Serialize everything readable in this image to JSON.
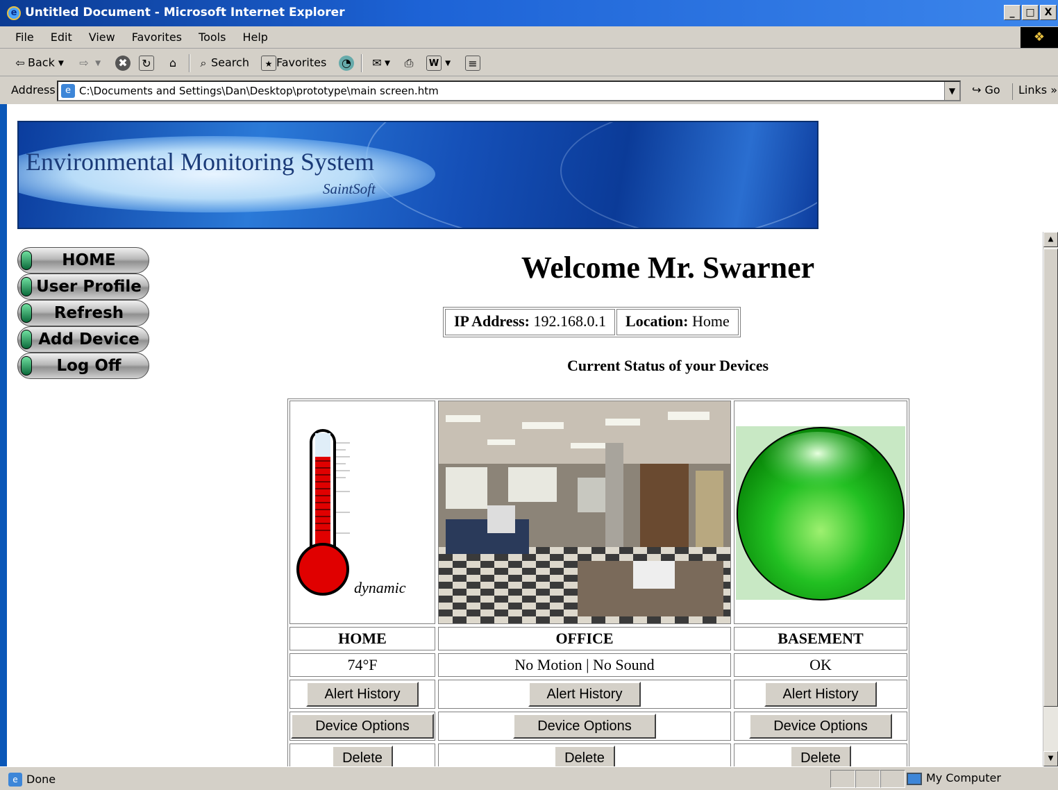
{
  "window": {
    "title": "Untitled Document - Microsoft Internet Explorer",
    "controls": [
      "_",
      "□",
      "X"
    ]
  },
  "menu": {
    "items": [
      "File",
      "Edit",
      "View",
      "Favorites",
      "Tools",
      "Help"
    ]
  },
  "toolbar": {
    "back": "Back",
    "search": "Search",
    "favorites": "Favorites"
  },
  "address": {
    "label": "Address",
    "url": "C:\\Documents and Settings\\Dan\\Desktop\\prototype\\main screen.htm",
    "go": "Go",
    "links": "Links"
  },
  "banner": {
    "title": "Environmental Monitoring System",
    "subtitle": "SaintSoft"
  },
  "nav": {
    "items": [
      "HOME",
      "User Profile",
      "Refresh",
      "Add Device",
      "Log Off"
    ]
  },
  "page": {
    "welcome": "Welcome Mr. Swarner",
    "ip_label": "IP Address:",
    "ip_value": "192.168.0.1",
    "location_label": "Location:",
    "location_value": "Home",
    "status_heading": "Current Status of your Devices"
  },
  "devices": [
    {
      "name": "HOME",
      "status": "74°F",
      "image": "thermometer",
      "image_caption": "dynamic"
    },
    {
      "name": "OFFICE",
      "status": "No Motion | No Sound",
      "image": "office-photo"
    },
    {
      "name": "BASEMENT",
      "status": "OK",
      "image": "green-status-orb"
    }
  ],
  "device_buttons": {
    "alert_history": "Alert History",
    "device_options": "Device Options",
    "delete": "Delete"
  },
  "statusbar": {
    "text": "Done",
    "zone": "My Computer"
  },
  "colors": {
    "title_bar": "#1d63d6",
    "chrome": "#d4d0c8",
    "nav_indicator": "#0b6a3a",
    "orb": "#22c022"
  }
}
